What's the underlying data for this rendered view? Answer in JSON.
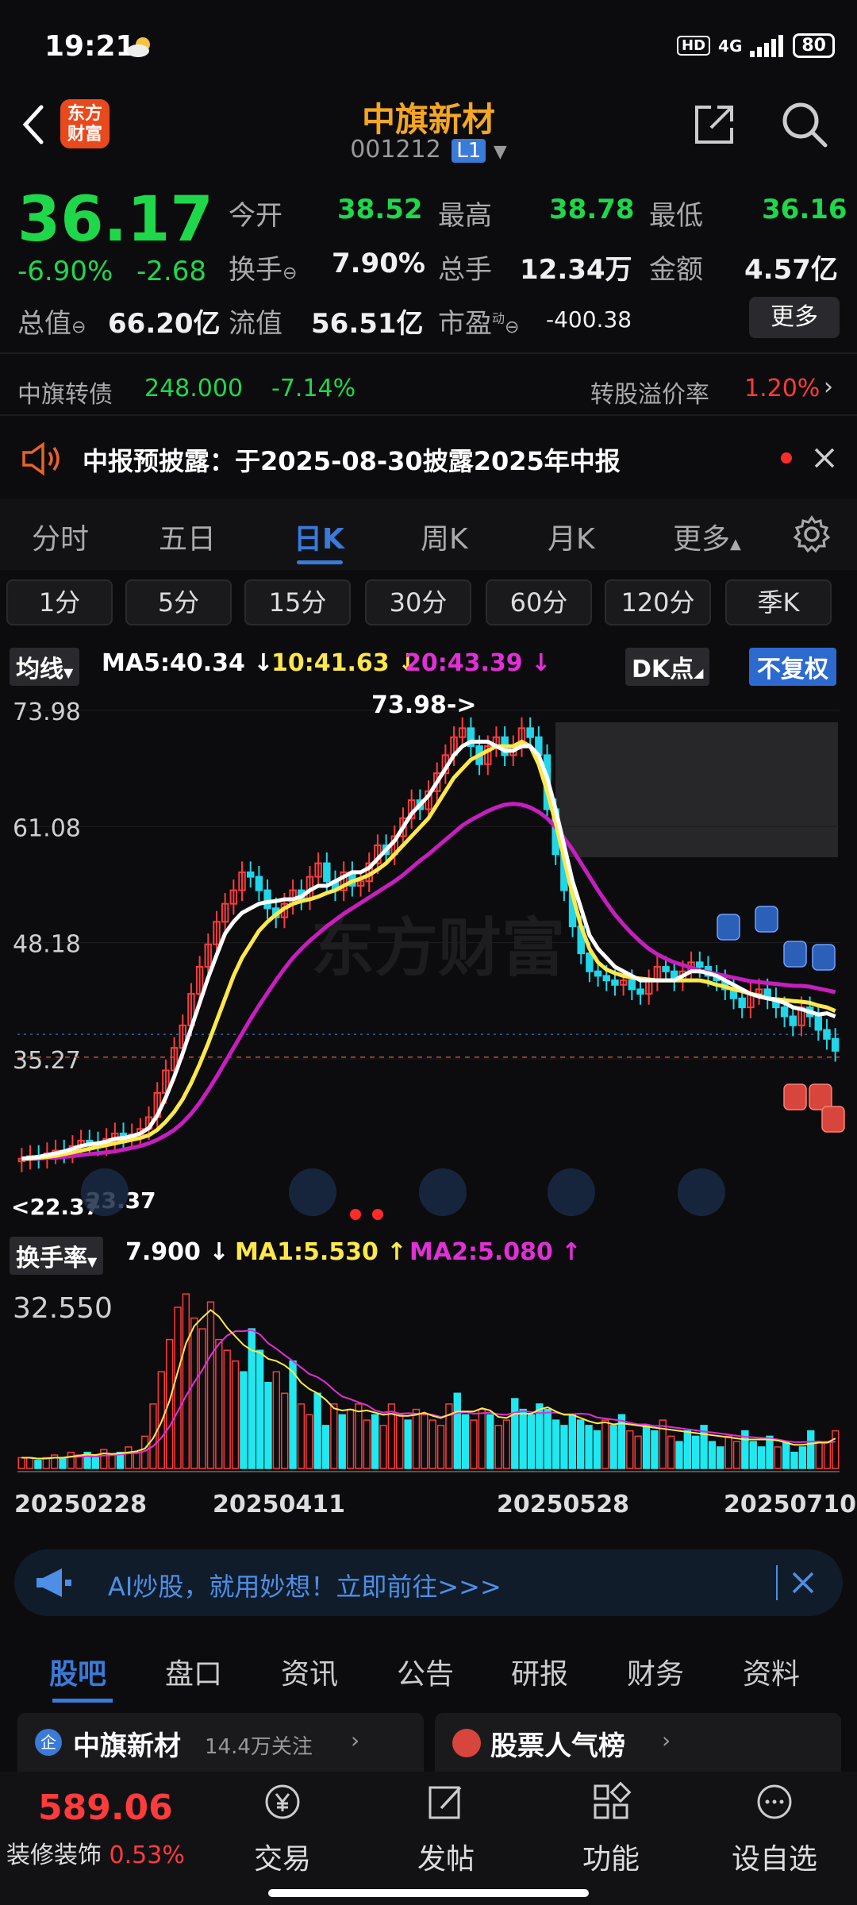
{
  "status": {
    "time": "19:21",
    "network": "4G",
    "battery": "80",
    "hd": "HD"
  },
  "header": {
    "title": "中旗新材",
    "code": "001212",
    "level": "L1",
    "logo_line1": "东方",
    "logo_line2": "财富"
  },
  "quote": {
    "price": "36.17",
    "change_pct": "-6.90%",
    "change": "-2.68",
    "open_label": "今开",
    "open": "38.52",
    "high_label": "最高",
    "high": "38.78",
    "low_label": "最低",
    "low": "36.16",
    "turnover_label": "换手",
    "turnover": "7.90%",
    "volume_label": "总手",
    "volume": "12.34万",
    "amount_label": "金额",
    "amount": "4.57亿",
    "mktcap_label": "总值",
    "mktcap": "66.20亿",
    "float_label": "流值",
    "float": "56.51亿",
    "pe_label": "市盈",
    "pe_sup": "动",
    "pe": "-400.38",
    "more": "更多"
  },
  "bond": {
    "name": "中旗转债",
    "price": "248.000",
    "pct": "-7.14%",
    "premium_label": "转股溢价率",
    "premium": "1.20%"
  },
  "notice": {
    "text": "中报预披露：于2025-08-30披露2025年中报"
  },
  "tabs": [
    "分时",
    "五日",
    "日K",
    "周K",
    "月K",
    "更多"
  ],
  "periods": [
    "1分",
    "5分",
    "15分",
    "30分",
    "60分",
    "120分",
    "季K"
  ],
  "ma": {
    "selector": "均线",
    "ma5": "MA5:40.34",
    "ma10": "10:41.63",
    "ma20": "20:43.39",
    "dk": "DK点",
    "fq": "不复权"
  },
  "chart_data": {
    "type": "candlestick",
    "y_ticks": [
      "73.98",
      "61.08",
      "48.18",
      "35.27"
    ],
    "ylim": [
      24,
      76
    ],
    "high_annotation": "73.98->",
    "low_annotation": "<22.37",
    "extra_annotation": "23.37",
    "closes": [
      24.2,
      24.5,
      24.3,
      24.8,
      25.1,
      24.9,
      25.6,
      26.2,
      26.0,
      25.7,
      26.4,
      27.0,
      26.6,
      26.9,
      27.5,
      28.8,
      31.5,
      34.0,
      36.5,
      39.0,
      42.5,
      45.5,
      48.0,
      50.5,
      52.5,
      54.0,
      56.0,
      55.5,
      54.0,
      52.0,
      51.0,
      52.5,
      54.0,
      53.0,
      55.5,
      57.0,
      55.0,
      54.0,
      56.0,
      54.5,
      55.0,
      57.0,
      59.0,
      58.0,
      60.0,
      62.0,
      64.0,
      63.0,
      65.0,
      67.0,
      69.0,
      71.0,
      72.0,
      70.0,
      68.0,
      70.0,
      71.0,
      69.0,
      70.0,
      72.0,
      71.0,
      69.0,
      63.0,
      58.0,
      54.0,
      50.0,
      47.0,
      45.0,
      44.5,
      44.0,
      43.5,
      44.0,
      43.0,
      42.5,
      44.0,
      45.5,
      45.0,
      44.0,
      45.0,
      46.0,
      45.5,
      44.5,
      44.0,
      43.0,
      42.0,
      41.0,
      42.5,
      43.0,
      42.0,
      41.0,
      40.0,
      39.0,
      41.0,
      40.0,
      38.5,
      37.5,
      36.17
    ],
    "ma5": [
      24.2,
      24.3,
      24.4,
      24.6,
      24.8,
      25.0,
      25.3,
      25.6,
      25.8,
      25.9,
      26.1,
      26.4,
      26.5,
      26.7,
      27.0,
      27.6,
      29.0,
      31.0,
      33.3,
      35.9,
      38.7,
      41.5,
      44.3,
      46.8,
      49.2,
      50.5,
      51.5,
      52.0,
      52.5,
      52.7,
      52.8,
      53.0,
      53.0,
      53.3,
      54.0,
      54.5,
      54.5,
      55.0,
      55.5,
      56.0,
      56.0,
      56.5,
      57.5,
      58.5,
      59.5,
      61.0,
      62.5,
      63.5,
      64.5,
      66.0,
      67.5,
      69.0,
      70.0,
      70.5,
      70.5,
      70.5,
      70.0,
      69.5,
      69.5,
      70.0,
      70.0,
      69.0,
      66.5,
      63.0,
      59.0,
      55.0,
      52.0,
      49.0,
      47.5,
      46.5,
      45.5,
      45.0,
      44.5,
      44.0,
      44.0,
      44.0,
      44.0,
      44.0,
      44.5,
      45.0,
      45.0,
      44.8,
      44.5,
      44.0,
      43.5,
      43.0,
      42.5,
      42.2,
      42.0,
      41.8,
      41.5,
      41.0,
      40.8,
      40.5,
      40.2,
      40.34,
      40.0
    ],
    "ma10": [
      24.2,
      24.2,
      24.3,
      24.4,
      24.5,
      24.7,
      24.9,
      25.1,
      25.3,
      25.5,
      25.7,
      25.9,
      26.1,
      26.3,
      26.5,
      26.8,
      27.4,
      28.3,
      29.4,
      30.8,
      32.6,
      34.7,
      37.0,
      39.5,
      42.0,
      44.5,
      46.5,
      48.0,
      49.5,
      50.5,
      51.3,
      52.0,
      52.5,
      52.8,
      53.0,
      53.3,
      53.7,
      54.0,
      54.5,
      55.0,
      55.3,
      55.7,
      56.3,
      57.0,
      58.0,
      59.0,
      60.0,
      61.0,
      62.0,
      63.5,
      65.0,
      66.5,
      67.5,
      68.5,
      69.0,
      69.5,
      70.0,
      70.0,
      70.0,
      70.5,
      70.0,
      68.0,
      65.0,
      61.5,
      57.5,
      53.5,
      50.0,
      47.5,
      46.0,
      45.2,
      44.8,
      44.5,
      44.3,
      44.2,
      44.1,
      44.0,
      44.0,
      44.0,
      44.0,
      44.0,
      44.0,
      43.8,
      43.5,
      43.3,
      43.0,
      42.8,
      42.5,
      42.3,
      42.0,
      41.9,
      41.8,
      41.7,
      41.63,
      41.5,
      41.2,
      41.0,
      40.6
    ],
    "ma20": [
      24.2,
      24.2,
      24.2,
      24.3,
      24.3,
      24.4,
      24.5,
      24.6,
      24.7,
      24.8,
      24.9,
      25.0,
      25.2,
      25.4,
      25.6,
      25.9,
      26.3,
      26.8,
      27.4,
      28.2,
      29.2,
      30.4,
      31.8,
      33.3,
      34.9,
      36.5,
      38.1,
      39.7,
      41.2,
      42.6,
      44.0,
      45.3,
      46.5,
      47.5,
      48.4,
      49.2,
      50.0,
      50.7,
      51.4,
      52.0,
      52.6,
      53.2,
      53.8,
      54.4,
      55.0,
      55.7,
      56.5,
      57.3,
      58.0,
      58.8,
      59.6,
      60.4,
      61.2,
      61.8,
      62.3,
      62.8,
      63.2,
      63.5,
      63.6,
      63.5,
      63.2,
      62.7,
      62.0,
      61.0,
      59.8,
      58.5,
      57.0,
      55.5,
      54.0,
      52.6,
      51.3,
      50.2,
      49.2,
      48.3,
      47.5,
      46.9,
      46.4,
      46.0,
      45.7,
      45.4,
      45.1,
      44.9,
      44.7,
      44.5,
      44.3,
      44.1,
      43.9,
      43.8,
      43.7,
      43.6,
      43.5,
      43.4,
      43.39,
      43.3,
      43.1,
      42.9,
      42.7
    ]
  },
  "vol": {
    "selector": "换手率",
    "value": "7.900",
    "ma1": "MA1:5.530",
    "ma2": "MA2:5.080",
    "y_tick": "32.550",
    "values": [
      2,
      2,
      1.5,
      2,
      2.5,
      2,
      3,
      2.5,
      3,
      2,
      3.5,
      2.5,
      3,
      4,
      3,
      6,
      12,
      18,
      24,
      30,
      32.5,
      28,
      26,
      31,
      24,
      22,
      20,
      18,
      26,
      22,
      16,
      18,
      14,
      20,
      12,
      10,
      14,
      8,
      12,
      10,
      11,
      12,
      9,
      10,
      8,
      12,
      10,
      9,
      11,
      10,
      9,
      8,
      12,
      14,
      10,
      9,
      11,
      10,
      8,
      9,
      13,
      11,
      10,
      12,
      11,
      9,
      8,
      10,
      9,
      8,
      7,
      9,
      8,
      10,
      7,
      6,
      8,
      7,
      9,
      6,
      5,
      7,
      6,
      8,
      5,
      4,
      6,
      5,
      7,
      5,
      4,
      6,
      4,
      5,
      3,
      4,
      7,
      5,
      5,
      7
    ]
  },
  "dates": [
    "20250228",
    "20250411",
    "20250528",
    "20250710"
  ],
  "ai": {
    "text": "AI炒股，就用妙想！立即前往>>>"
  },
  "subtabs": [
    "股吧",
    "盘口",
    "资讯",
    "公告",
    "研报",
    "财务",
    "资料"
  ],
  "cards": {
    "left_title": "中旗新材",
    "left_sub": "14.4万关注",
    "right_title": "股票人气榜"
  },
  "bottom": {
    "index_price": "589.06",
    "index_name": "装修装饰",
    "index_pct": "0.53%",
    "items": [
      "交易",
      "发帖",
      "功能",
      "设自选"
    ]
  },
  "colors": {
    "up": "#ff3b3b",
    "down": "#1fd84a",
    "accent": "#3a7ad8",
    "title": "#f5a623"
  }
}
